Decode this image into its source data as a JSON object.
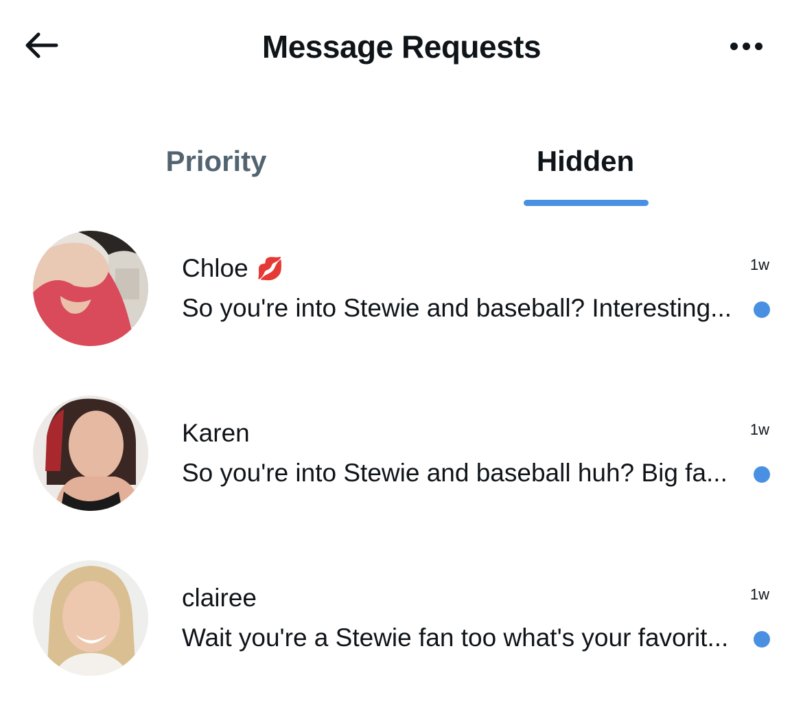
{
  "header": {
    "title": "Message Requests",
    "back_icon": "arrow-left-icon",
    "more_icon": "more-horizontal-icon"
  },
  "tabs": [
    {
      "label": "Priority",
      "active": false
    },
    {
      "label": "Hidden",
      "active": true
    }
  ],
  "colors": {
    "accent": "#4a90e2",
    "text": "#0f1419",
    "muted": "#536471"
  },
  "conversations": [
    {
      "name": "Chloe",
      "emoji": "💋",
      "preview": "So you're into Stewie and baseball? Interesting...",
      "time": "1w",
      "unread": true
    },
    {
      "name": "Karen",
      "emoji": "",
      "preview": "So you're into Stewie and baseball huh? Big fa...",
      "time": "1w",
      "unread": true
    },
    {
      "name": "clairee",
      "emoji": "",
      "preview": "Wait you're a Stewie fan too what's your favorit...",
      "time": "1w",
      "unread": true
    }
  ]
}
